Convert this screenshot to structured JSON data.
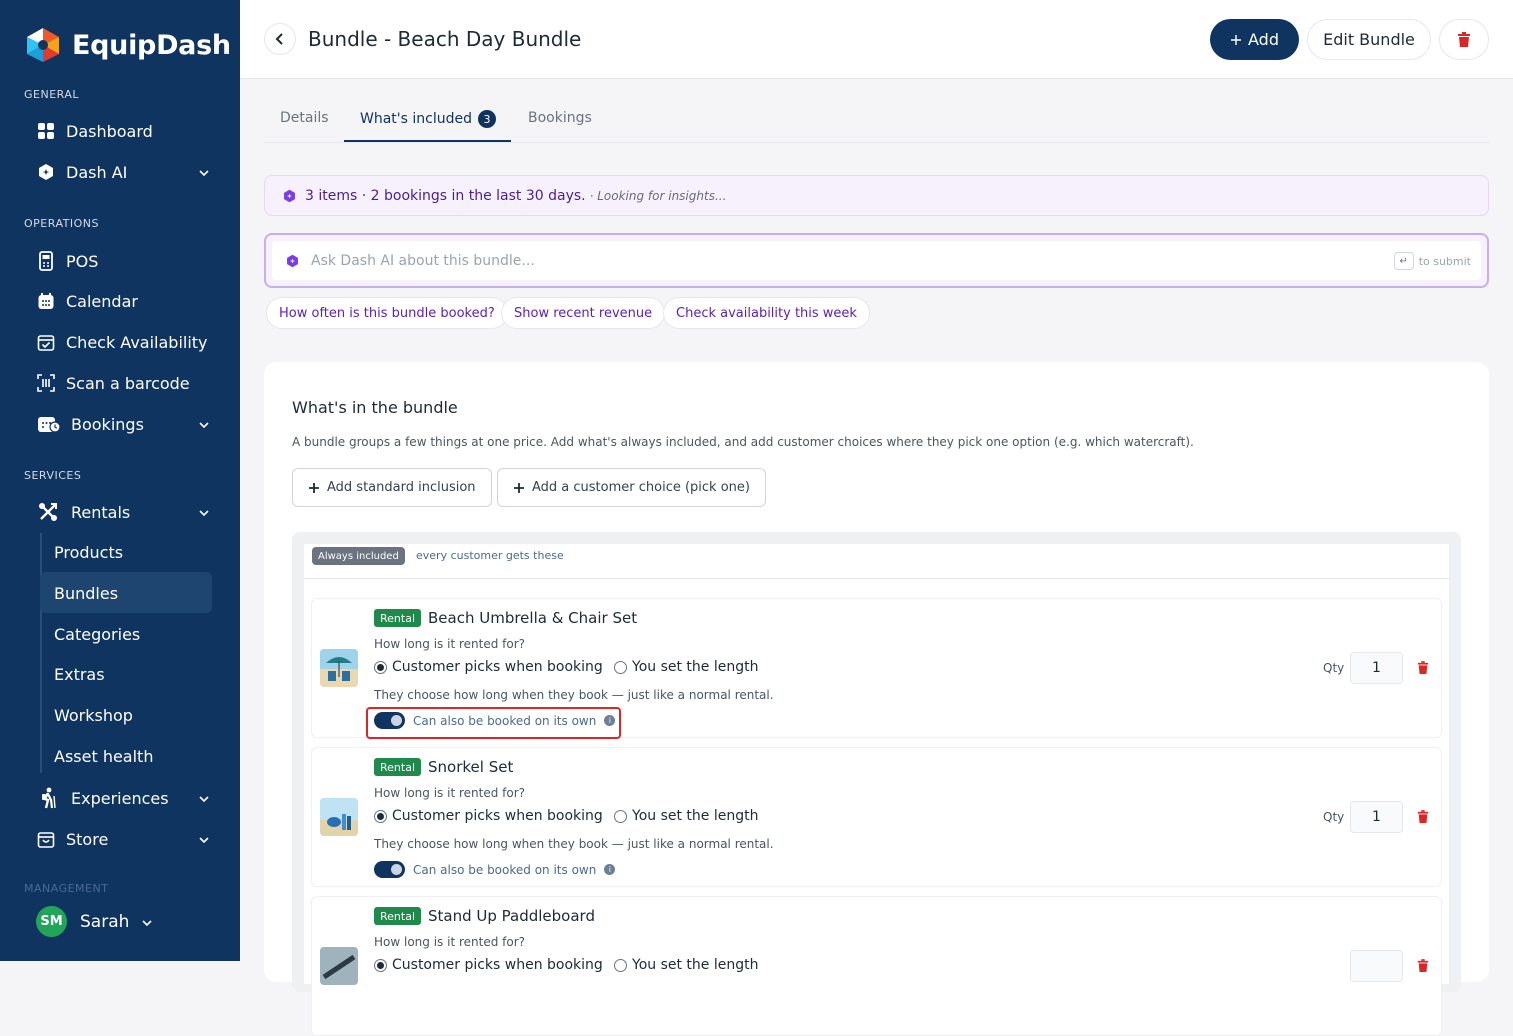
{
  "brand": {
    "name": "EquipDash"
  },
  "sidebar": {
    "sections": {
      "general": "GENERAL",
      "operations": "OPERATIONS",
      "services": "SERVICES",
      "management": "MANAGEMENT"
    },
    "items": {
      "dashboard": "Dashboard",
      "dash_ai": "Dash AI",
      "pos": "POS",
      "calendar": "Calendar",
      "check_availability": "Check Availability",
      "scan": "Scan a barcode",
      "bookings": "Bookings",
      "rentals": "Rentals",
      "experiences": "Experiences",
      "store": "Store"
    },
    "rentals_sub": {
      "products": "Products",
      "bundles": "Bundles",
      "categories": "Categories",
      "extras": "Extras",
      "workshop": "Workshop",
      "asset_health": "Asset health"
    },
    "user": {
      "initials": "SM",
      "name": "Sarah"
    }
  },
  "header": {
    "title": "Bundle - Beach Day Bundle",
    "add_label": "Add",
    "edit_label": "Edit Bundle"
  },
  "tabs": {
    "details": "Details",
    "included": "What's included",
    "included_count": "3",
    "bookings": "Bookings"
  },
  "insight": {
    "summary": "3 items · 2 bookings in the last 30 days.",
    "status": "· Looking for insights..."
  },
  "ask": {
    "placeholder": "Ask Dash AI about this bundle...",
    "hint": "to submit",
    "key": "↵"
  },
  "suggestions": [
    "How often is this bundle booked?",
    "Show recent revenue",
    "Check availability this week"
  ],
  "bundle": {
    "title": "What's in the bundle",
    "description": "A bundle groups a few things at one price. Add what's always included, and add customer choices where they pick one option (e.g. which watercraft).",
    "add_standard": "Add standard inclusion",
    "add_choice": "Add a customer choice (pick one)",
    "group_badge": "Always included",
    "group_desc": "every customer gets these",
    "qty_label": "Qty",
    "items": [
      {
        "type": "Rental",
        "name": "Beach Umbrella & Chair Set",
        "question": "How long is it rented for?",
        "option_a": "Customer picks when booking",
        "option_b": "You set the length",
        "hint": "They choose how long when they book — just like a normal rental.",
        "toggle_label": "Can also be booked on its own",
        "qty": "1"
      },
      {
        "type": "Rental",
        "name": "Snorkel Set",
        "question": "How long is it rented for?",
        "option_a": "Customer picks when booking",
        "option_b": "You set the length",
        "hint": "They choose how long when they book — just like a normal rental.",
        "toggle_label": "Can also be booked on its own",
        "qty": "1"
      },
      {
        "type": "Rental",
        "name": "Stand Up Paddleboard",
        "question": "How long is it rented for?",
        "option_a": "Customer picks when booking",
        "option_b": "You set the length",
        "hint": "",
        "toggle_label": "",
        "qty": ""
      }
    ]
  },
  "colors": {
    "primary": "#0f3460",
    "accent_purple": "#5b21b6",
    "rental_green": "#1f8a4c",
    "danger": "#dc2626"
  }
}
